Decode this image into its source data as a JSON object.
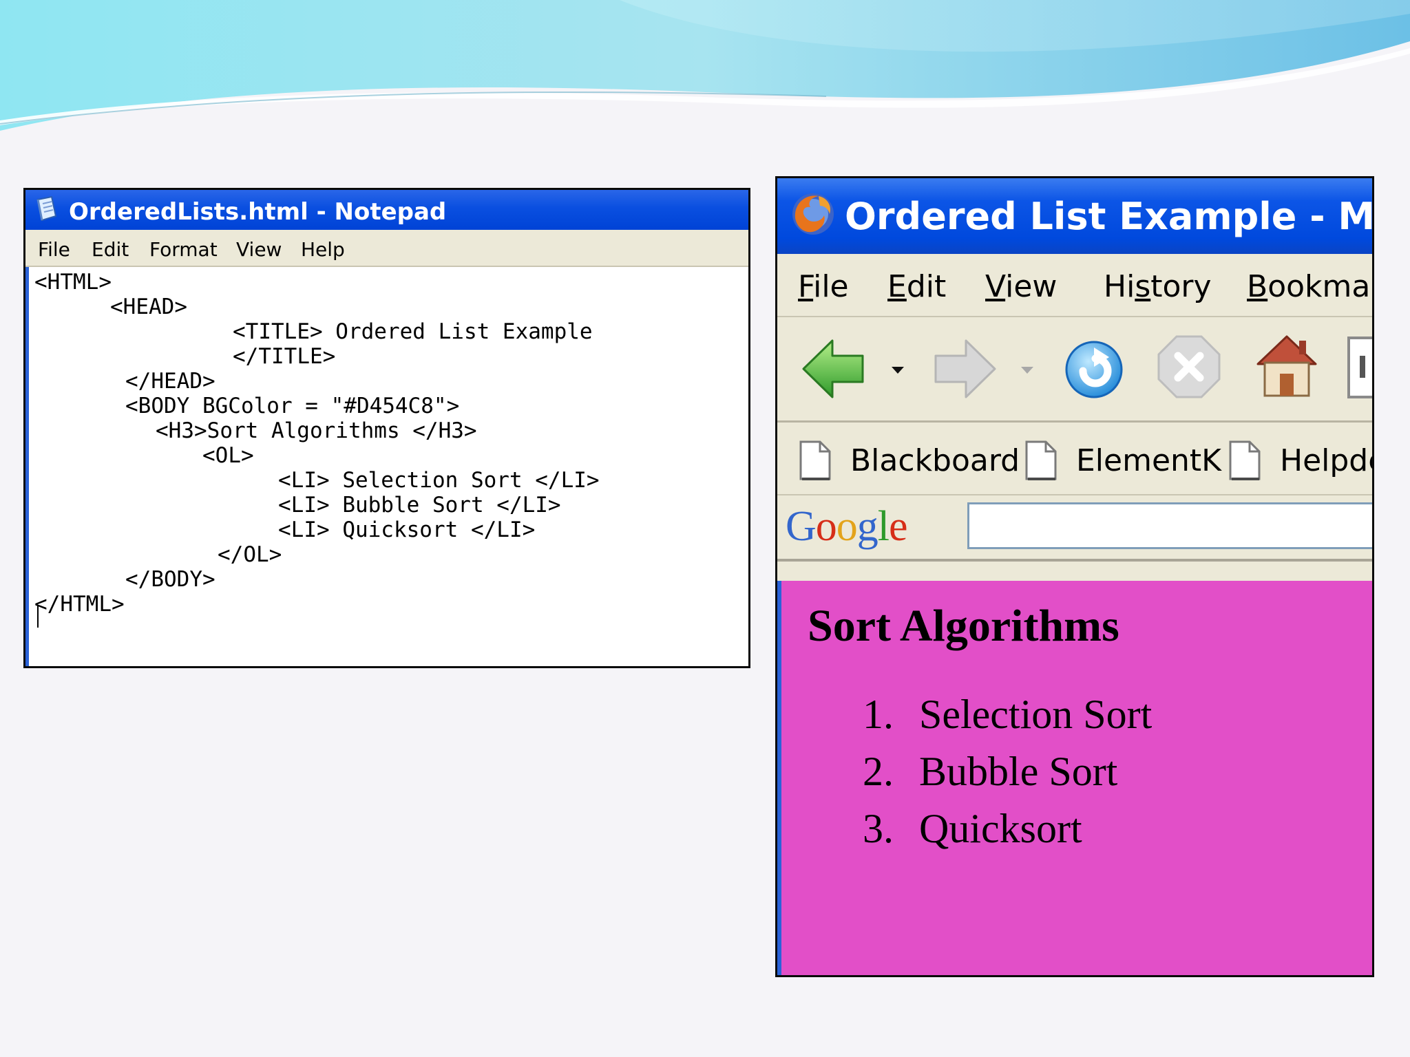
{
  "notepad": {
    "title": "OrderedLists.html - Notepad",
    "menu": [
      "File",
      "Edit",
      "Format",
      "View",
      "Help"
    ],
    "code_lines": [
      "<HTML>",
      "<HEAD>",
      "<TITLE> Ordered List Example",
      "</TITLE>",
      "</HEAD>",
      "<BODY BGColor = \"#D454C8\">",
      "<H3>Sort Algorithms </H3>",
      "<OL>",
      "<LI> Selection Sort </LI>",
      "<LI> Bubble Sort </LI>",
      "<LI> Quicksort </LI>",
      "</OL>",
      "</BODY>",
      "</HTML>"
    ]
  },
  "browser": {
    "title": "Ordered List Example - Mozilla",
    "menu": [
      {
        "first": "F",
        "rest": "ile"
      },
      {
        "first": "E",
        "rest": "dit"
      },
      {
        "first": "V",
        "rest": "iew"
      },
      {
        "first": "Hi",
        "underline": "s",
        "rest": "tory"
      },
      {
        "first": "B",
        "rest": "ookmarks"
      }
    ],
    "nav_icons": [
      "back-icon",
      "back-history-dropdown-icon",
      "forward-icon",
      "forward-history-dropdown-icon",
      "reload-icon",
      "stop-icon",
      "home-icon"
    ],
    "bookmarks": [
      "Blackboard",
      "ElementK",
      "Helpdesk"
    ],
    "search": {
      "logo": "Google",
      "value": ""
    },
    "page": {
      "bgcolor": "#D454C8",
      "heading": "Sort Algorithms",
      "items": [
        {
          "num": "1.",
          "text": "Selection Sort"
        },
        {
          "num": "2.",
          "text": "Bubble Sort"
        },
        {
          "num": "3.",
          "text": "Quicksort"
        }
      ]
    }
  }
}
